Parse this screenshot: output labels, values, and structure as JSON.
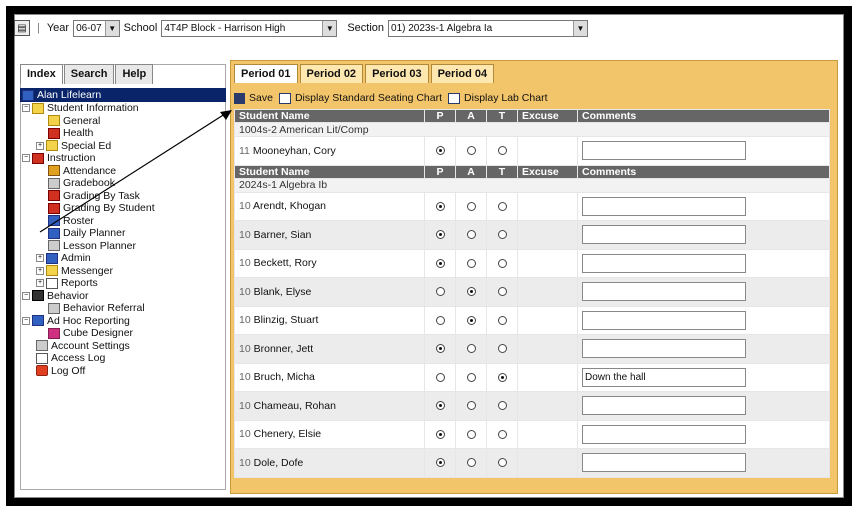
{
  "topbar": {
    "year_label": "Year",
    "year_value": "06-07",
    "school_label": "School",
    "school_value": "4T4P Block - Harrison High",
    "section_label": "Section",
    "section_value": "01) 2023s-1 Algebra Ia"
  },
  "left_tabs": [
    "Index",
    "Search",
    "Help"
  ],
  "tree": [
    {
      "label": "Alan Lifelearn",
      "icon": "user-icon",
      "selected": true
    },
    {
      "label": "Student Information",
      "icon": "folder-icon",
      "pm": "-"
    },
    {
      "label": "General",
      "icon": "folder-icon"
    },
    {
      "label": "Health",
      "icon": "health-icon"
    },
    {
      "label": "Special Ed",
      "icon": "folder-icon",
      "pm": "+"
    },
    {
      "label": "Instruction",
      "icon": "instruction-icon",
      "pm": "-"
    },
    {
      "label": "Attendance",
      "icon": "attendance-icon"
    },
    {
      "label": "Gradebook",
      "icon": "gradebook-icon"
    },
    {
      "label": "Grading By Task",
      "icon": "grading-icon"
    },
    {
      "label": "Grading By Student",
      "icon": "grading-icon"
    },
    {
      "label": "Roster",
      "icon": "roster-icon"
    },
    {
      "label": "Daily Planner",
      "icon": "planner-icon"
    },
    {
      "label": "Lesson Planner",
      "icon": "planner-icon"
    },
    {
      "label": "Admin",
      "icon": "admin-icon",
      "pm": "+"
    },
    {
      "label": "Messenger",
      "icon": "folder-icon",
      "pm": "+"
    },
    {
      "label": "Reports",
      "icon": "reports-icon",
      "pm": "+"
    },
    {
      "label": "Behavior",
      "icon": "behavior-icon",
      "pm": "-"
    },
    {
      "label": "Behavior Referral",
      "icon": "referral-icon"
    },
    {
      "label": "Ad Hoc Reporting",
      "icon": "adhoc-icon",
      "pm": "-"
    },
    {
      "label": "Cube Designer",
      "icon": "cube-icon"
    },
    {
      "label": "Account Settings",
      "icon": "settings-icon"
    },
    {
      "label": "Access Log",
      "icon": "log-icon"
    },
    {
      "label": "Log Off",
      "icon": "logoff-icon"
    }
  ],
  "period_tabs": [
    "Period 01",
    "Period 02",
    "Period 03",
    "Period 04"
  ],
  "actions": {
    "save": "Save",
    "seating": "Display Standard Seating Chart",
    "lab": "Display Lab Chart"
  },
  "columns": {
    "name": "Student Name",
    "p": "P",
    "a": "A",
    "t": "T",
    "excuse": "Excuse",
    "comments": "Comments"
  },
  "section1": {
    "title": "1004s-2 American Lit/Comp",
    "students": [
      {
        "grade": "11",
        "name": "Mooneyhan, Cory",
        "status": "P",
        "comment": ""
      }
    ]
  },
  "section2": {
    "title": "2024s-1 Algebra Ib",
    "students": [
      {
        "grade": "10",
        "name": "Arendt, Khogan",
        "status": "P",
        "comment": ""
      },
      {
        "grade": "10",
        "name": "Barner, Sian",
        "status": "P",
        "comment": ""
      },
      {
        "grade": "10",
        "name": "Beckett, Rory",
        "status": "P",
        "comment": ""
      },
      {
        "grade": "10",
        "name": "Blank, Elyse",
        "status": "A",
        "comment": ""
      },
      {
        "grade": "10",
        "name": "Blinzig, Stuart",
        "status": "A",
        "comment": ""
      },
      {
        "grade": "10",
        "name": "Bronner, Jett",
        "status": "P",
        "comment": ""
      },
      {
        "grade": "10",
        "name": "Bruch, Micha",
        "status": "T",
        "comment": "Down the hall"
      },
      {
        "grade": "10",
        "name": "Chameau, Rohan",
        "status": "P",
        "comment": ""
      },
      {
        "grade": "10",
        "name": "Chenery, Elsie",
        "status": "P",
        "comment": ""
      },
      {
        "grade": "10",
        "name": "Dole, Dofe",
        "status": "P",
        "comment": ""
      }
    ]
  },
  "colors": {
    "panel": "#f3c56a",
    "header": "#666666",
    "selected": "#0a246a"
  }
}
